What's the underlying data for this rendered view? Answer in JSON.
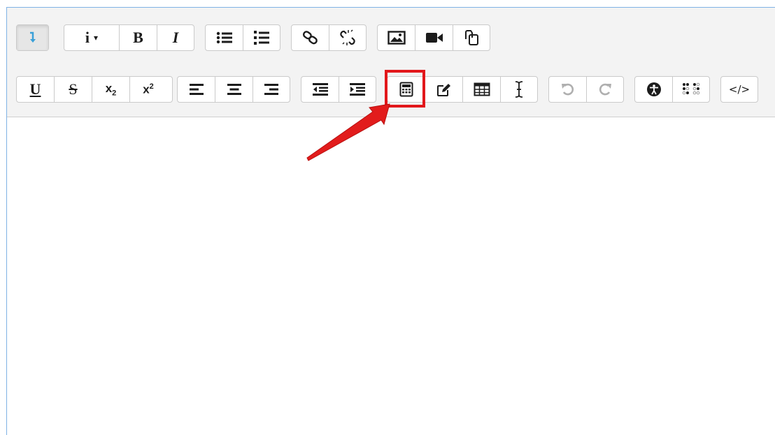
{
  "toolbar": {
    "row1": {
      "collapse": {
        "icon": "collapse-arrow-icon"
      },
      "paragraph_style": {
        "label": "i",
        "caret": "▾"
      },
      "bold": {
        "label": "B"
      },
      "italic": {
        "label": "I"
      },
      "unordered_list": {
        "icon": "unordered-list-icon"
      },
      "ordered_list": {
        "icon": "ordered-list-icon"
      },
      "link": {
        "icon": "link-icon"
      },
      "unlink": {
        "icon": "unlink-icon"
      },
      "image": {
        "icon": "image-icon"
      },
      "media": {
        "icon": "video-camera-icon"
      },
      "manage_files": {
        "icon": "copy-files-icon"
      }
    },
    "row2": {
      "underline": {
        "label": "U"
      },
      "strikethrough": {
        "label": "S"
      },
      "subscript": {
        "base": "x",
        "script": "2"
      },
      "superscript": {
        "base": "x",
        "script": "2"
      },
      "align_left": {
        "icon": "align-left-icon"
      },
      "align_center": {
        "icon": "align-center-icon"
      },
      "align_right": {
        "icon": "align-right-icon"
      },
      "outdent": {
        "icon": "outdent-icon"
      },
      "indent": {
        "icon": "indent-icon"
      },
      "equation": {
        "icon": "calculator-icon"
      },
      "special_character": {
        "icon": "edit-icon"
      },
      "table": {
        "icon": "table-icon"
      },
      "clear_formatting": {
        "icon": "text-cursor-icon"
      },
      "undo": {
        "icon": "undo-icon"
      },
      "redo": {
        "icon": "redo-icon"
      },
      "accessibility_checker": {
        "icon": "accessibility-icon"
      },
      "screenreader_helper": {
        "icon": "braille-icon"
      },
      "html": {
        "label": "</>"
      }
    }
  },
  "annotation": {
    "highlight_color": "#e2171b",
    "arrow_color": "#e21c1c"
  },
  "colors": {
    "toolbar_bg": "#f3f3f3",
    "editor_border": "#7fb2e5",
    "collapse_icon": "#3aa0d8"
  }
}
